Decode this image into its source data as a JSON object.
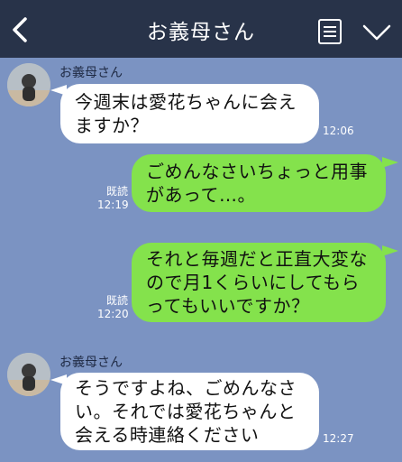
{
  "header": {
    "title": "お義母さん",
    "back_icon": "chevron-left-icon",
    "notes_icon": "notes-icon",
    "menu_icon": "chevron-down-icon"
  },
  "colors": {
    "header_bg": "#283349",
    "chat_bg": "#7b93c2",
    "incoming_bubble": "#ffffff",
    "outgoing_bubble": "#84e24c"
  },
  "messages": [
    {
      "direction": "in",
      "sender": "お義母さん",
      "text": "今週末は愛花ちゃんに会え\nますか？",
      "time": "12:06"
    },
    {
      "direction": "out",
      "read": "既読",
      "text": "ごめんなさいちょっと用事\nがあって…。",
      "time": "12:19"
    },
    {
      "direction": "out",
      "read": "既読",
      "text": "それと毎週だと正直大変な\nので月1くらいにしてもら\nってもいいですか？",
      "time": "12:20"
    },
    {
      "direction": "in",
      "sender": "お義母さん",
      "text": "そうですよね、ごめんなさ\nい。それでは愛花ちゃんと\n会える時連絡ください",
      "time": "12:27"
    }
  ]
}
